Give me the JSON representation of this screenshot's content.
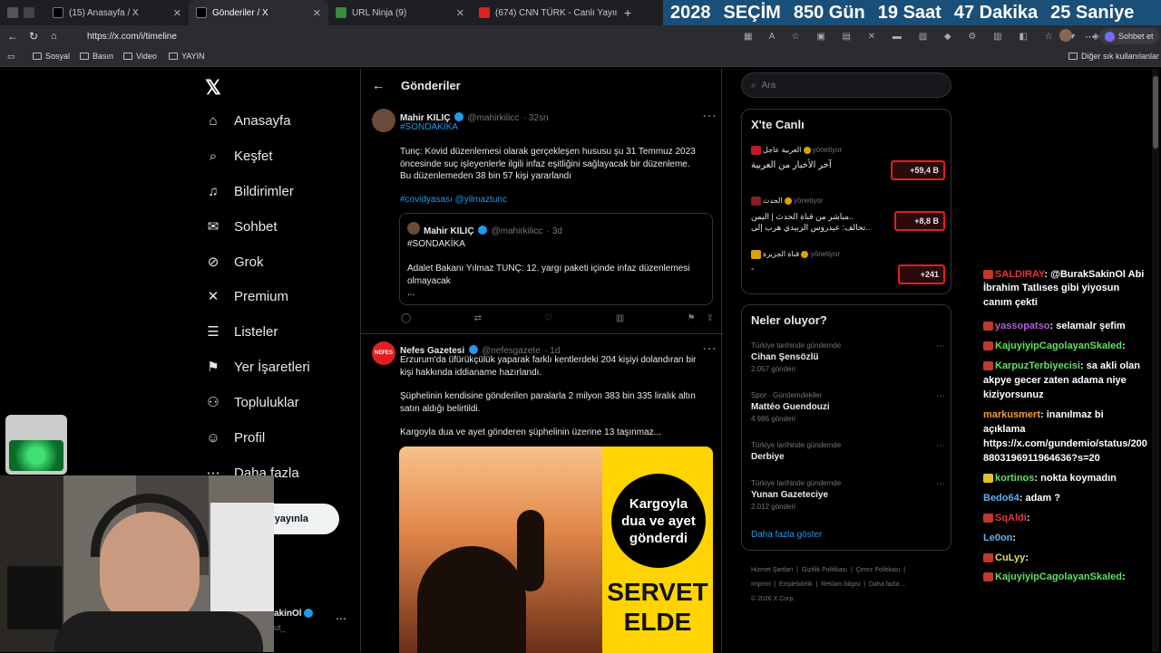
{
  "browser": {
    "tabs": [
      {
        "label": "(15) Anasayfa / X"
      },
      {
        "label": "Gönderiler / X"
      },
      {
        "label": "URL Ninja (9)"
      },
      {
        "label": "(674) CNN TÜRK - Canlı Yayın"
      }
    ],
    "address": "https://x.com/i/timeline",
    "chat_button": "Sohbet et",
    "bookmarks": [
      "Sosyal",
      "Basın",
      "Video",
      "YAYIN"
    ],
    "other_bookmarks": "Diğer sık kullanılanlar"
  },
  "countdown": {
    "year": "2028",
    "word": "SEÇİM",
    "days": "850 Gün",
    "hours": "19 Saat",
    "minutes": "47 Dakika",
    "seconds": "25 Saniye"
  },
  "sidebar": {
    "items": [
      {
        "label": "Anasayfa",
        "icon": "home-icon"
      },
      {
        "label": "Keşfet",
        "icon": "search-icon"
      },
      {
        "label": "Bildirimler",
        "icon": "bell-icon"
      },
      {
        "label": "Sohbet",
        "icon": "mail-icon"
      },
      {
        "label": "Grok",
        "icon": "grok-icon"
      },
      {
        "label": "Premium",
        "icon": "x-icon"
      },
      {
        "label": "Listeler",
        "icon": "list-icon"
      },
      {
        "label": "Yer İşaretleri",
        "icon": "bookmark-icon"
      },
      {
        "label": "Topluluklar",
        "icon": "people-icon"
      },
      {
        "label": "Profil",
        "icon": "person-icon"
      },
      {
        "label": "Daha fazla",
        "icon": "more-icon"
      }
    ],
    "post_button": "yayınla",
    "account_name": "akinOl",
    "account_handle": "ut_"
  },
  "main": {
    "title": "Gönderiler",
    "tweets": [
      {
        "name": "Mahir KILIÇ",
        "handle": "@mahirkilicc",
        "time": "· 32sn",
        "tag": "#SONDAKİKA",
        "lines": [
          "Tunç: Kovid düzenlemesi olarak gerçekleşen hususu şu 31 Temmuz 2023",
          "öncesinde suç işleyenlerle ilgili infaz eşitliğini sağlayacak bir düzenleme.",
          "Bu düzenlemeden 38 bin 57 kişi yararlandı"
        ],
        "links": "#covidyasası @yilmaztunc",
        "quote": {
          "name": "Mahir KILIÇ",
          "handle": "@mahirkilicc",
          "time": "· 3d",
          "tag": "#SONDAKİKA",
          "lines": [
            "Adalet Bakanı Yılmaz TUNÇ:  12. yargı paketi içinde infaz düzenlemesi",
            "olmayacak",
            "..."
          ]
        }
      },
      {
        "name": "Nefes Gazetesi",
        "handle": "@nefesgazete",
        "time": "· 1d",
        "lines": [
          "Erzurum'da üfürükçülük yaparak farklı kentlerdeki 204 kişiyi dolandıran bir",
          "kişi hakkında iddianame hazırlandı.",
          "",
          "Şüphelinin kendisine gönderilen paralarla 2 milyon 383 bin 335 liralık altın",
          "satın aldığı belirtildi.",
          "",
          "Kargoyla dua ve ayet gönderen şüphelinin üzerine 13 taşınmaz..."
        ],
        "image_text": [
          "Kargoyla",
          "dua ve ayet",
          "gönderdi"
        ],
        "image_big": [
          "SERVET",
          "ELDE"
        ],
        "avatar_text": "NEFES"
      }
    ]
  },
  "right": {
    "search_placeholder": "Ara",
    "live_title": "X'te Canlı",
    "live": [
      {
        "source": "العربية عاجل",
        "role": "yönetiyor",
        "title": "آخر الأخبار من العربية",
        "count": "+59,4 B",
        "color": "#c0182a"
      },
      {
        "source": "الحدث",
        "role": "yönetiyor",
        "title_lines": [
          "مباشر من قناة الحدث | اليمن..",
          "تحالف: عيدروس الزبيدي هرب إلى.."
        ],
        "count": "+8,8 B",
        "color": "#8a1c2a"
      },
      {
        "source": "قناة الجزيرة",
        "role": "yönetiyor",
        "title": "-",
        "count": "+241",
        "color": "#d9a400"
      }
    ],
    "trends_title": "Neler oluyor?",
    "trends": [
      {
        "context": "Türkiye tarihinde gündemde",
        "name": "Cihan Şensözlü",
        "count": "2.057 gönderi"
      },
      {
        "context": "Spor · Gündemdekiler",
        "name": "Mattéo Guendouzi",
        "count": "4.986 gönderi"
      },
      {
        "context": "Türkiye tarihinde gündemde",
        "name": "Derbiye",
        "count": ""
      },
      {
        "context": "Türkiye tarihinde gündemde",
        "name": "Yunan Gazeteciye",
        "count": "2.012 gönderi"
      }
    ],
    "show_more": "Daha fazla göster",
    "footer": [
      "Hizmet Şartları",
      "Gizlilik Politikası",
      "Çerez Politikası",
      "Imprint",
      "Erişilebilirlik",
      "Reklam bilgisi",
      "Daha fazla ...",
      "© 2026 X Corp."
    ]
  },
  "chat": [
    {
      "user": "SALDIRAY",
      "msg": ": @BurakSakinOl Abi",
      "color": "#e0393e"
    },
    {
      "user": "",
      "msg": "İbrahim Tatlıses gibi yiyosun",
      "color": "#ffffff"
    },
    {
      "user": "",
      "msg": "canım çekti",
      "color": "#ffffff"
    },
    {
      "user": "yassopatso",
      "msg": ": selamalr şefim",
      "color": "#b05fd4"
    },
    {
      "user": "KajuyiyipCagolayanSkaled",
      "msg": ":",
      "color": "#5fe05f"
    },
    {
      "user": "KarpuzTerbiyecisi",
      "msg": ": sa akli olan",
      "color": "#5fe05f"
    },
    {
      "user": "",
      "msg": "akpye gecer zaten adama niye",
      "color": "#ffffff"
    },
    {
      "user": "",
      "msg": "kiziyorsunuz",
      "color": "#ffffff"
    },
    {
      "user": "markusmert",
      "msg": ": inanılmaz bi",
      "color": "#f0a030"
    },
    {
      "user": "",
      "msg": "açıklama",
      "color": "#ffffff"
    },
    {
      "user": "",
      "msg": "https://x.com/gundemio/status/200",
      "color": "#ffffff"
    },
    {
      "user": "",
      "msg": "8803196911964636?s=20",
      "color": "#ffffff"
    },
    {
      "user": "kortinos",
      "msg": ": nokta koymadın",
      "color": "#5fe05f"
    },
    {
      "user": "Bedo64",
      "msg": ": adam ?",
      "color": "#5fb0f0"
    },
    {
      "user": "SqAldi",
      "msg": ":",
      "color": "#e0393e"
    },
    {
      "user": "Le0on",
      "msg": ":",
      "color": "#5fb0f0"
    },
    {
      "user": "CuLyy",
      "msg": ":",
      "color": "#e0e040"
    },
    {
      "user": "KajuyiyipCagolayanSkaled",
      "msg": ":",
      "color": "#5fe05f"
    }
  ]
}
